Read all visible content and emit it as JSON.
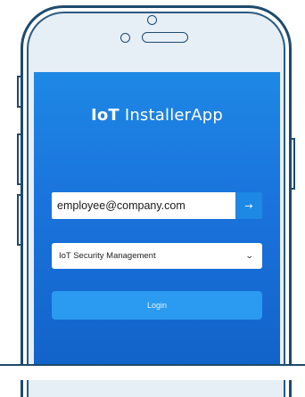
{
  "app": {
    "brand_bold": "IoT",
    "brand_light": "InstallerApp"
  },
  "login_form": {
    "email_value": "employee@company.com",
    "email_submit_glyph": "→",
    "tenant_select": {
      "selected": "IoT Security Management",
      "chevron_glyph": "⌄"
    },
    "login_label": "Login"
  },
  "colors": {
    "screen_top": "#1e88e5",
    "screen_bottom": "#1263c9",
    "login_button": "#2a9bf0",
    "phone_outline": "#1e4a6d"
  }
}
